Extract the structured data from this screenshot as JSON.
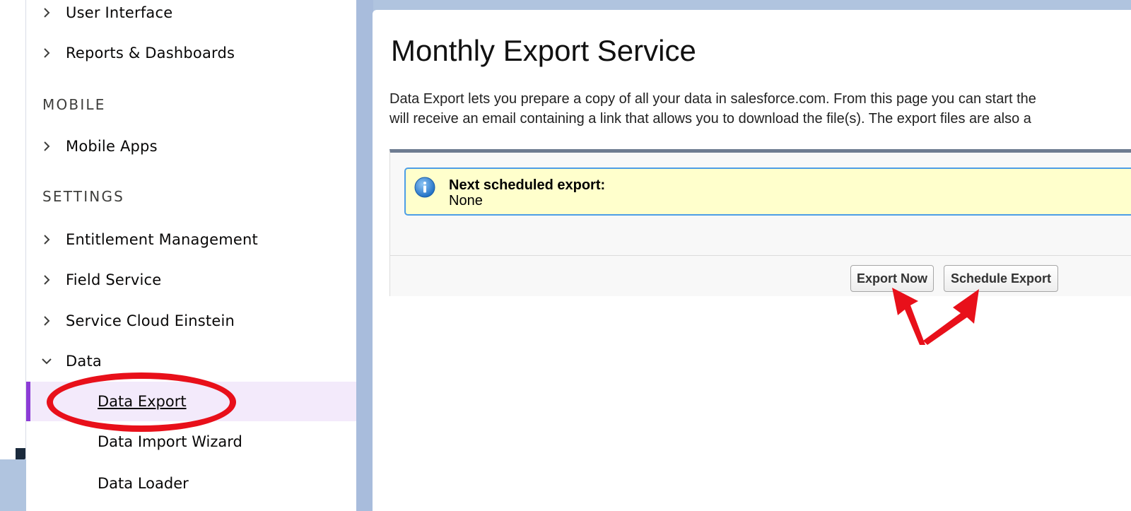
{
  "sidebar": {
    "items_top": [
      {
        "label": "User Interface"
      },
      {
        "label": "Reports & Dashboards"
      }
    ],
    "section_mobile": "MOBILE",
    "mobile_items": [
      {
        "label": "Mobile Apps"
      }
    ],
    "section_settings": "SETTINGS",
    "settings_items": [
      {
        "label": "Entitlement Management"
      },
      {
        "label": "Field Service"
      },
      {
        "label": "Service Cloud Einstein"
      },
      {
        "label": "Data"
      }
    ],
    "data_subitems": [
      {
        "label": "Data Export",
        "selected": true
      },
      {
        "label": "Data Import Wizard"
      },
      {
        "label": "Data Loader"
      }
    ]
  },
  "main": {
    "title": "Monthly Export Service",
    "description_line1": "Data Export lets you prepare a copy of all your data in salesforce.com. From this page you can start the",
    "description_line2": "will receive an email containing a link that allows you to download the file(s). The export files are also a",
    "info_title": "Next scheduled export:",
    "info_value": "None",
    "export_now_label": "Export Now",
    "schedule_export_label": "Schedule Export"
  },
  "colors": {
    "annotation": "#e8101a",
    "selected_accent": "#8c3cd6",
    "info_border": "#4d9ee6",
    "info_bg": "#ffffcc"
  },
  "icons": [
    "chevron-right-icon",
    "chevron-down-icon",
    "info-icon",
    "annotation-arrow"
  ]
}
